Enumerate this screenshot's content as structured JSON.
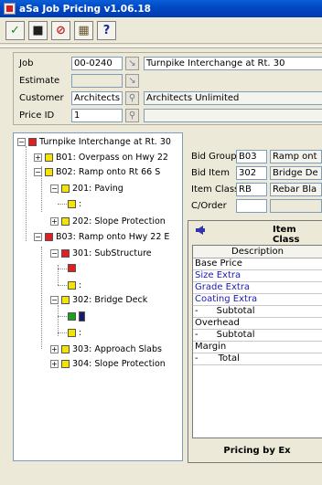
{
  "app": {
    "title": "aSa Job Pricing v1.06.18"
  },
  "toolbar": {
    "buttons": [
      {
        "glyph": "✓",
        "color": "#1c8a1c"
      },
      {
        "glyph": "■",
        "color": "#202020"
      },
      {
        "glyph": "⊘",
        "color": "#c81e1e"
      },
      {
        "glyph": "▦",
        "color": "#6a5a2a"
      },
      {
        "glyph": "?",
        "color": "#1a2aa0"
      }
    ]
  },
  "header": {
    "job_label": "Job",
    "job_value": "00-0240",
    "job_desc": "Turnpike Interchange at Rt. 30",
    "estimate_label": "Estimate",
    "estimate_value": "",
    "estimate_desc": "",
    "customer_label": "Customer",
    "customer_value": "Architects",
    "customer_desc": "Architects Unlimited",
    "priceid_label": "Price ID",
    "priceid_value": "1",
    "priceid_desc": ""
  },
  "tree": {
    "root": "Turnpike Interchange at Rt. 30",
    "b01": "B01: Overpass on Hwy 22",
    "b02": "B02: Ramp onto Rt 66 S",
    "i201": "201: Paving",
    "i201_child": ":",
    "i202": "202: Slope Protection",
    "b03": "B03: Ramp onto Hwy 22 E",
    "i301": "301: SubStructure",
    "i301_child": ":",
    "i302": "302: Bridge Deck",
    "i302_child": ":",
    "i303": "303: Approach Slabs",
    "i304": "304: Slope Protection"
  },
  "detail": {
    "bid_group_label": "Bid Group",
    "bid_group_value": "B03",
    "bid_group_desc": "Ramp ont",
    "bid_item_label": "Bid Item",
    "bid_item_value": "302",
    "bid_item_desc": "Bridge De",
    "item_class_label": "Item Class",
    "item_class_value": "RB",
    "item_class_desc": "Rebar Bla",
    "corder_label": "C/Order",
    "corder_value": ""
  },
  "item_class": {
    "title": "Item Class",
    "col_description": "Description",
    "rows": [
      "Base Price",
      "Size Extra",
      "Grade Extra",
      "Coating Extra",
      "Subtotal",
      "Overhead",
      "Subtotal",
      "Margin",
      "Total"
    ],
    "footer": "Pricing by Ex"
  },
  "colors": {
    "red": "#e02020",
    "yellow": "#f5e400",
    "green": "#1aa31a",
    "navy": "#1a1a6a",
    "link_blue": "#1a1ab0"
  }
}
